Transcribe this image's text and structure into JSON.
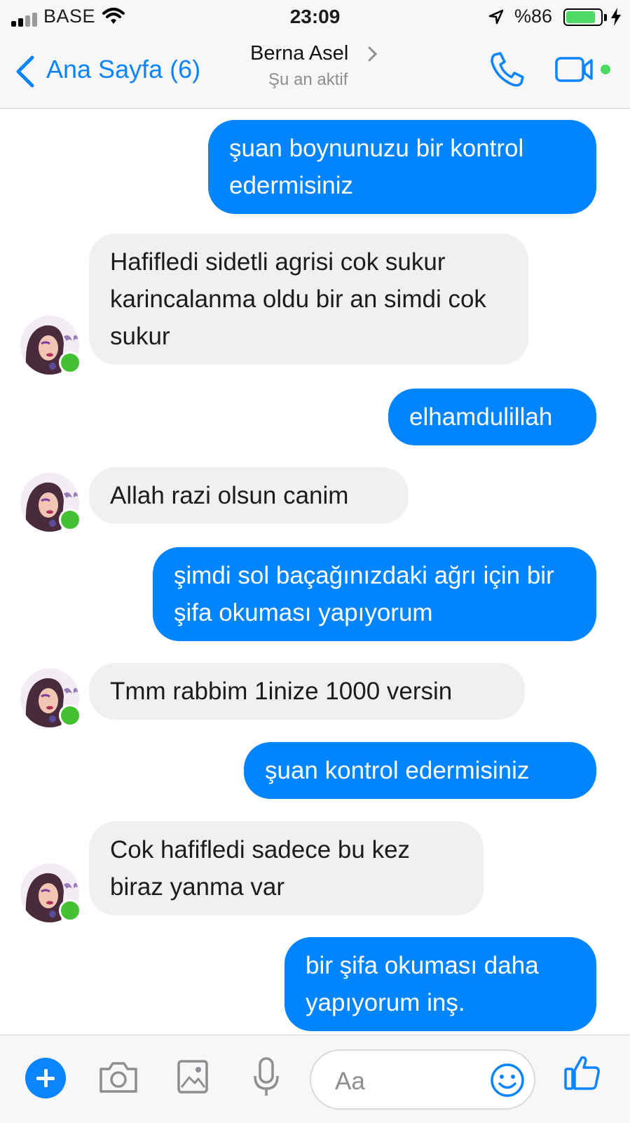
{
  "status_bar": {
    "carrier": "BASE",
    "time": "23:09",
    "battery_percent": "%86",
    "battery_level": 0.86,
    "icons": [
      "signal-icon",
      "wifi-icon",
      "location-arrow-icon",
      "battery-icon",
      "charging-bolt-icon"
    ]
  },
  "header": {
    "back_label": "Ana Sayfa (6)",
    "contact_name": "Berna Asel",
    "contact_status": "Şu an aktif",
    "icons": [
      "back-chevron-icon",
      "chevron-right-icon",
      "phone-icon",
      "video-camera-icon"
    ]
  },
  "messages": [
    {
      "from": "me",
      "text": "şuan boynunuzu bir kontrol edermisiniz"
    },
    {
      "from": "contact",
      "text": "Hafifledi sidetli agrisi cok sukur karincalanma oldu bir an simdi cok sukur"
    },
    {
      "from": "me",
      "text": "elhamdulillah"
    },
    {
      "from": "contact",
      "text": "Allah razi olsun canim"
    },
    {
      "from": "me",
      "text": "şimdi sol baçağınızdaki ağrı için bir şifa okuması yapıyorum"
    },
    {
      "from": "contact",
      "text": "Tmm rabbim 1inize 1000 versin"
    },
    {
      "from": "me",
      "text": "şuan kontrol edermisiniz"
    },
    {
      "from": "contact",
      "text": "Cok hafifledi sadece bu kez biraz yanma var"
    },
    {
      "from": "me",
      "text": "bir şifa okuması daha yapıyorum inş."
    }
  ],
  "composer": {
    "placeholder": "Aa",
    "icons": [
      "plus-icon",
      "camera-icon",
      "gallery-icon",
      "microphone-icon",
      "emoji-icon",
      "thumbs-up-icon"
    ]
  },
  "colors": {
    "outgoing_bubble": "#0084ff",
    "incoming_bubble": "#f1f0f0",
    "accent": "#0a84ff",
    "online": "#43c132"
  }
}
